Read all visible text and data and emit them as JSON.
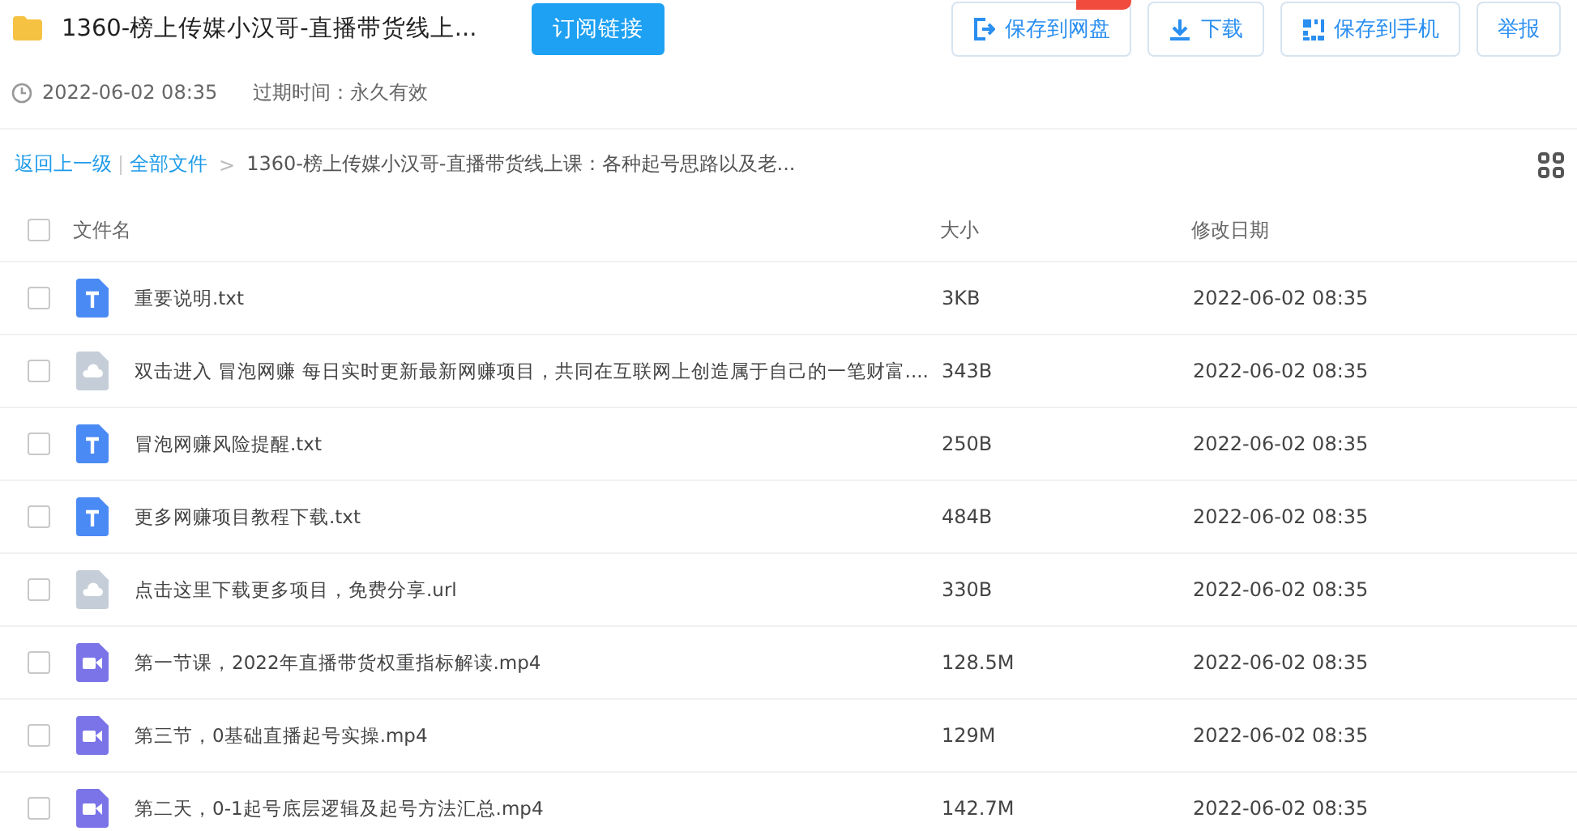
{
  "title": "1360-榜上传媒小汉哥-直播带货线上...",
  "subscribe_button": "订阅链接",
  "actions": [
    {
      "kind": "save",
      "label": "保存到网盘",
      "badge": true
    },
    {
      "kind": "download",
      "label": "下载",
      "badge": false
    },
    {
      "kind": "phone",
      "label": "保存到手机",
      "badge": false
    },
    {
      "kind": "report",
      "label": "举报",
      "badge": false
    }
  ],
  "meta": {
    "time": "2022-06-02 08:35",
    "expiry": "过期时间：永久有效"
  },
  "breadcrumb": {
    "back": "返回上一级",
    "all": "全部文件",
    "separator": ">",
    "current": "1360-榜上传媒小汉哥-直播带货线上课：各种起号思路以及老..."
  },
  "table": {
    "columns": [
      "文件名",
      "大小",
      "修改日期"
    ],
    "select_all_checked": false,
    "rows": [
      {
        "kind": "txt",
        "name": "重要说明.txt",
        "size": "3KB",
        "date": "2022-06-02 08:35",
        "checked": false
      },
      {
        "kind": "link",
        "name": "双击进入 冒泡网赚 每日实时更新最新网赚项目，共同在互联网上创造属于自己的一笔财富....",
        "size": "343B",
        "date": "2022-06-02 08:35",
        "checked": false
      },
      {
        "kind": "txt",
        "name": "冒泡网赚风险提醒.txt",
        "size": "250B",
        "date": "2022-06-02 08:35",
        "checked": false
      },
      {
        "kind": "txt",
        "name": "更多网赚项目教程下载.txt",
        "size": "484B",
        "date": "2022-06-02 08:35",
        "checked": false
      },
      {
        "kind": "link",
        "name": "点击这里下载更多项目，免费分享.url",
        "size": "330B",
        "date": "2022-06-02 08:35",
        "checked": false
      },
      {
        "kind": "video",
        "name": "第一节课，2022年直播带货权重指标解读.mp4",
        "size": "128.5M",
        "date": "2022-06-02 08:35",
        "checked": false
      },
      {
        "kind": "video",
        "name": "第三节，0基础直播起号实操.mp4",
        "size": "129M",
        "date": "2022-06-02 08:35",
        "checked": false
      },
      {
        "kind": "video",
        "name": "第二天，0-1起号底层逻辑及起号方法汇总.mp4",
        "size": "142.7M",
        "date": "2022-06-02 08:35",
        "checked": false
      }
    ]
  }
}
